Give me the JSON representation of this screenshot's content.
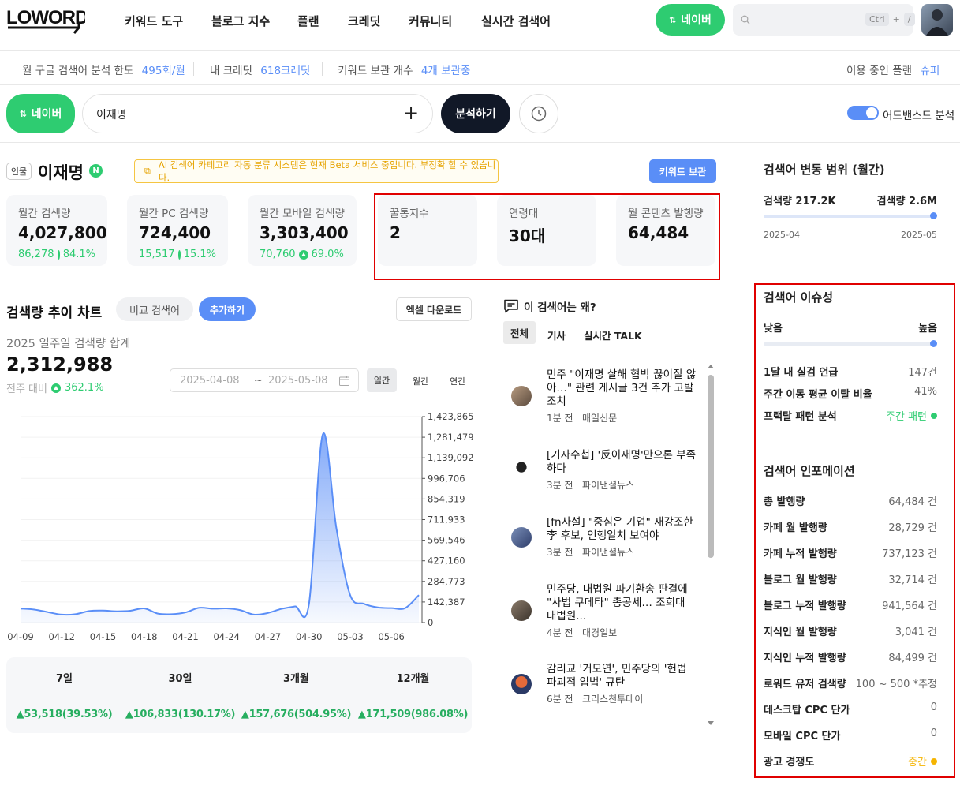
{
  "header": {
    "logo_text": "LOWORD",
    "nav": [
      "키워드 도구",
      "블로그 지수",
      "플랜",
      "크레딧",
      "커뮤니티",
      "실시간 검색어"
    ],
    "naver_button": "네이버",
    "search_shortcut_ctrl": "Ctrl",
    "search_shortcut_plus": "+",
    "search_shortcut_key": "/"
  },
  "infobar": {
    "google_limit_label": "월 구글 검색어 분석 한도",
    "google_limit_value": "495회/월",
    "credit_label": "내 크레딧",
    "credit_value": "618크레딧",
    "keep_label": "키워드 보관 개수",
    "keep_value": "4개 보관중",
    "plan_label": "이용 중인 플랜",
    "plan_value": "슈퍼"
  },
  "searchbar": {
    "engine": "네이버",
    "query": "이재명",
    "analyze": "분석하기",
    "advanced": "어드밴스드 분석"
  },
  "keyword": {
    "category": "인물",
    "name": "이재명",
    "naver_badge": "N",
    "notice": "AI 검색어 카테고리 자동 분류 시스템은 현재 Beta 서비스 중입니다. 부정확 할 수 있습니다.",
    "save_button": "키워드 보관"
  },
  "stats": [
    {
      "label": "월간 검색량",
      "value": "4,027,800",
      "delta": "86,278",
      "pct": "84.1%"
    },
    {
      "label": "월간 PC 검색량",
      "value": "724,400",
      "delta": "15,517",
      "pct": "15.1%"
    },
    {
      "label": "월간 모바일 검색량",
      "value": "3,303,400",
      "delta": "70,760",
      "pct": "69.0%"
    }
  ],
  "stats2": [
    {
      "label": "꿀통지수",
      "value": "2"
    },
    {
      "label": "연령대",
      "value": "30대"
    },
    {
      "label": "월 콘텐츠 발행량",
      "value": "64,484"
    }
  ],
  "trend": {
    "title": "검색량 추이 차트",
    "compare": "비교 검색어",
    "add": "추가하기",
    "excel": "엑셀 다운로드",
    "subtitle": "2025 일주일 검색량 합계",
    "total": "2,312,988",
    "wow_label": "전주 대비",
    "wow_value": "362.1%",
    "date_from": "2025-04-08",
    "date_sep": "~",
    "date_to": "2025-05-08",
    "periods": [
      "일간",
      "월간",
      "연간"
    ]
  },
  "chart_data": {
    "type": "area",
    "x_ticks": [
      "04-09",
      "04-12",
      "04-15",
      "04-18",
      "04-21",
      "04-24",
      "04-27",
      "04-30",
      "05-03",
      "05-06"
    ],
    "y_ticks": [
      "1,423,865",
      "1,281,479",
      "1,139,092",
      "996,706",
      "854,319",
      "711,933",
      "569,546",
      "427,160",
      "284,773",
      "142,387",
      "0"
    ],
    "ylim": [
      0,
      1423865
    ],
    "x": [
      "04-09",
      "04-10",
      "04-11",
      "04-12",
      "04-13",
      "04-14",
      "04-15",
      "04-16",
      "04-17",
      "04-18",
      "04-19",
      "04-20",
      "04-21",
      "04-22",
      "04-23",
      "04-24",
      "04-25",
      "04-26",
      "04-27",
      "04-28",
      "04-29",
      "04-30",
      "05-01",
      "05-02",
      "05-03",
      "05-04",
      "05-05",
      "05-06",
      "05-07",
      "05-08"
    ],
    "values": [
      97000,
      90000,
      72000,
      55000,
      58000,
      80000,
      83000,
      78000,
      82000,
      98000,
      62000,
      58000,
      70000,
      102000,
      96000,
      98000,
      86000,
      55000,
      66000,
      95000,
      112000,
      128000,
      1300000,
      650000,
      190000,
      130000,
      105000,
      100000,
      100000,
      190000
    ],
    "color": "#5a8ef7"
  },
  "summary": {
    "headers": [
      "7일",
      "30일",
      "3개월",
      "12개월"
    ],
    "values": [
      "▲53,518(39.53%)",
      "▲106,833(130.17%)",
      "▲157,676(504.95%)",
      "▲171,509(986.08%)"
    ]
  },
  "news": {
    "title": "이 검색어는 왜?",
    "tabs": [
      "전체",
      "기사",
      "실시간 TALK"
    ],
    "items": [
      {
        "title": "민주 \"이재명 살해 협박 끊이질 않아…\" 관련 게시글 3건 추가 고발 조치",
        "time": "1분 전",
        "source": "매일신문"
      },
      {
        "title": "[기자수첩] '反이재명'만으론 부족하다",
        "time": "3분 전",
        "source": "파이낸셜뉴스"
      },
      {
        "title": "[fn사설] \"중심은 기업\" 재강조한 李 후보, 언행일치 보여야",
        "time": "3분 전",
        "source": "파이낸셜뉴스"
      },
      {
        "title": "민주당, 대법원 파기환송 판결에 \"사법 쿠데타\" 총공세… 조희대 대법원...",
        "time": "4분 전",
        "source": "대경일보"
      },
      {
        "title": "감리교 '거모연', 민주당의 '헌법 파괴적 입법' 규탄",
        "time": "6분 전",
        "source": "크리스천투데이"
      }
    ]
  },
  "range": {
    "title": "검색어 변동 범위 (월간)",
    "min_label": "검색량 217.2K",
    "max_label": "검색량 2.6M",
    "from": "2025-04",
    "to": "2025-05",
    "level": 1.0
  },
  "issue": {
    "title": "검색어 이슈성",
    "low": "낮음",
    "high": "높음",
    "level": 1.0,
    "rows": [
      {
        "k": "1달 내 실검 언급",
        "v": "147건"
      },
      {
        "k": "주간 이동 평균 이탈 비율",
        "v": "41%"
      },
      {
        "k": "프랙탈 패턴 분석",
        "v": "주간 패턴"
      }
    ]
  },
  "info": {
    "title": "검색어 인포메이션",
    "rows": [
      {
        "k": "총 발행량",
        "v": "64,484 건"
      },
      {
        "k": "카페 월 발행량",
        "v": "28,729 건"
      },
      {
        "k": "카페 누적 발행량",
        "v": "737,123 건"
      },
      {
        "k": "블로그 월 발행량",
        "v": "32,714 건"
      },
      {
        "k": "블로그 누적 발행량",
        "v": "941,564 건"
      },
      {
        "k": "지식인 월 발행량",
        "v": "3,041 건"
      },
      {
        "k": "지식인 누적 발행량",
        "v": "84,499 건"
      },
      {
        "k": "로워드 유저 검색량",
        "v": "100 ~ 500 *추정"
      },
      {
        "k": "데스크탑 CPC 단가",
        "v": "0"
      },
      {
        "k": "모바일 CPC 단가",
        "v": "0"
      },
      {
        "k": "광고 경쟁도",
        "v": "중간"
      }
    ]
  }
}
